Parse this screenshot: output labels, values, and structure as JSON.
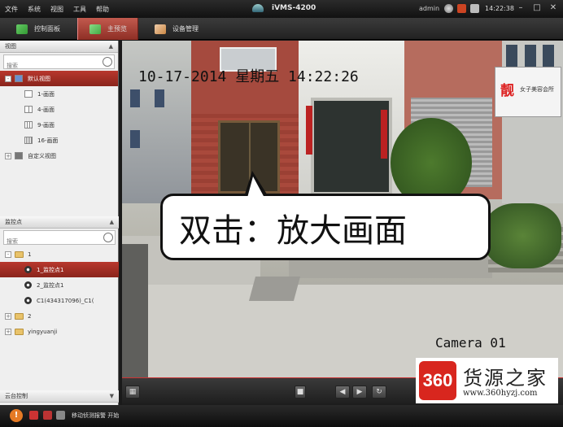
{
  "menubar": {
    "items": [
      "文件",
      "系统",
      "视图",
      "工具",
      "帮助"
    ],
    "app_title": "iVMS-4200",
    "user": "admin",
    "clock": "14:22:38"
  },
  "tabs": [
    {
      "label": "控制面板"
    },
    {
      "label": "主预览"
    },
    {
      "label": "设备管理"
    }
  ],
  "view_panel": {
    "header": "视图",
    "search_placeholder": "搜索",
    "default_view": "默认视图",
    "layouts": [
      "1-画面",
      "4-画面",
      "9-画面",
      "16-画面"
    ],
    "custom_view": "自定义视图"
  },
  "camera_panel": {
    "header": "监控点",
    "search_placeholder": "搜索",
    "group_1": "1",
    "cameras": [
      "1_监控点1",
      "2_监控点1",
      "C1(434317096)_C1("
    ],
    "group_2": "2",
    "group_3": "yingyuanji"
  },
  "ptz_panel": {
    "header": "云台控制"
  },
  "video": {
    "osd_time": "10-17-2014 星期五 14:22:26",
    "osd_camera": "Camera 01",
    "callout": "双击：放大画面",
    "sign_text": "女子美容会所"
  },
  "watermark": {
    "logo": "360",
    "title": "货源之家",
    "url": "www.360hyzj.com"
  },
  "status": {
    "text": "移动侦测报警 开始"
  },
  "colors": {
    "accent": "#b8382d",
    "menubar_bg": "#1a1a1a",
    "panel_bg": "#efefef"
  },
  "icons": {
    "view_panel": [
      "search-icon",
      "monitor-icon",
      "layout-icon"
    ],
    "camera_panel": [
      "search-icon",
      "folder-icon",
      "camera-icon"
    ]
  }
}
